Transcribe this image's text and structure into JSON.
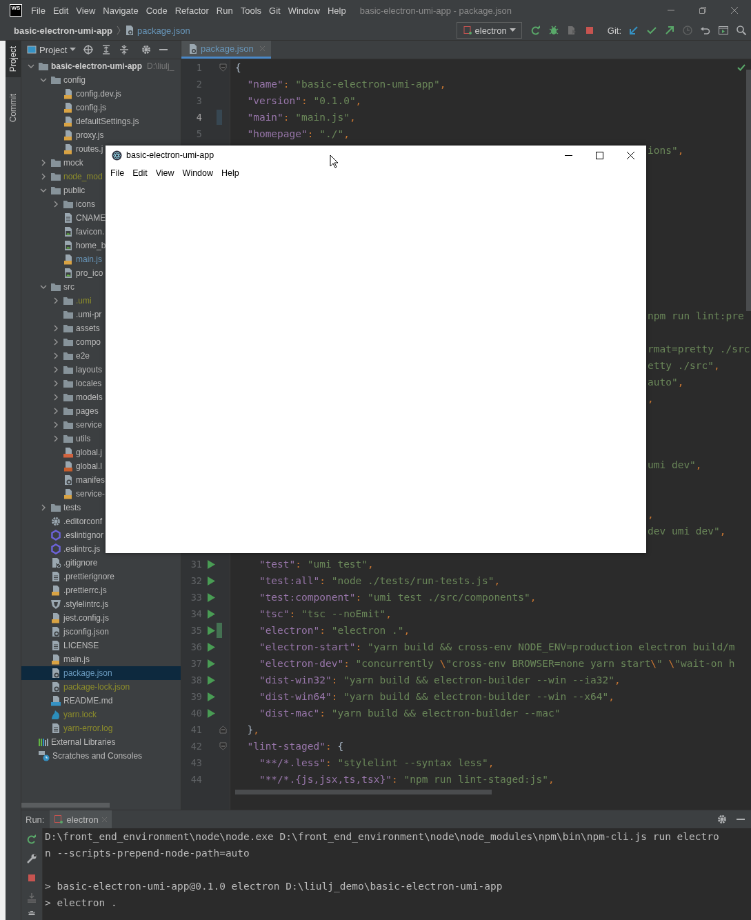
{
  "ide_title_bar": {
    "logo": "WS",
    "menu": [
      {
        "label": "File"
      },
      {
        "label": "Edit"
      },
      {
        "label": "View"
      },
      {
        "label": "Navigate"
      },
      {
        "label": "Code"
      },
      {
        "label": "Refactor"
      },
      {
        "label": "Run"
      },
      {
        "label": "Tools"
      },
      {
        "label": "Git"
      },
      {
        "label": "Window"
      },
      {
        "label": "Help"
      }
    ],
    "title": "basic-electron-umi-app - package.json"
  },
  "navigation_bar": {
    "project": "basic-electron-umi-app",
    "file": "package.json",
    "run_config": "electron",
    "git_label": "Git:"
  },
  "tool_stripe": [
    {
      "label": "Project",
      "selected": true
    },
    {
      "label": "Commit",
      "selected": false
    }
  ],
  "project_panel": {
    "title": "Project",
    "tree": [
      {
        "name": "basic-electron-umi-app",
        "path": "D:\\liulj_",
        "kind": "root",
        "expanded": true,
        "selected": false,
        "color": "#cfcfcf",
        "children": [
          {
            "name": "config",
            "kind": "folder",
            "expanded": true,
            "selected": false,
            "color": "#bbbbbb",
            "children": [
              {
                "name": "config.dev.js",
                "kind": "js",
                "selected": false,
                "color": "#bbbbbb"
              },
              {
                "name": "config.js",
                "kind": "js",
                "selected": false,
                "color": "#bbbbbb"
              },
              {
                "name": "defaultSettings.js",
                "kind": "js",
                "selected": false,
                "color": "#bbbbbb"
              },
              {
                "name": "proxy.js",
                "kind": "js",
                "selected": false,
                "color": "#bbbbbb"
              },
              {
                "name": "routes.j",
                "kind": "js",
                "selected": false,
                "color": "#bbbbbb"
              }
            ]
          },
          {
            "name": "mock",
            "kind": "folder",
            "expanded": false,
            "selected": false,
            "color": "#bbbbbb"
          },
          {
            "name": "node_mod",
            "kind": "folder",
            "expanded": false,
            "selected": false,
            "color": "#8d8d2b"
          },
          {
            "name": "public",
            "kind": "folder",
            "expanded": true,
            "selected": false,
            "color": "#bbbbbb",
            "children": [
              {
                "name": "icons",
                "kind": "folder",
                "expanded": false,
                "selected": false,
                "color": "#bbbbbb"
              },
              {
                "name": "CNAME",
                "kind": "text",
                "selected": false,
                "color": "#bbbbbb"
              },
              {
                "name": "favicon.",
                "kind": "image",
                "selected": false,
                "color": "#bbbbbb"
              },
              {
                "name": "home_b",
                "kind": "image",
                "selected": false,
                "color": "#bbbbbb"
              },
              {
                "name": "main.js",
                "kind": "js",
                "selected": false,
                "color": "#6897bb"
              },
              {
                "name": "pro_ico",
                "kind": "image",
                "selected": false,
                "color": "#bbbbbb"
              }
            ]
          },
          {
            "name": "src",
            "kind": "folder",
            "expanded": true,
            "selected": false,
            "color": "#bbbbbb",
            "children": [
              {
                "name": ".umi",
                "kind": "folder",
                "expanded": false,
                "selected": false,
                "color": "#8d8d2b"
              },
              {
                "name": ".umi-pr",
                "kind": "folder",
                "selected": false,
                "color": "#bbbbbb"
              },
              {
                "name": "assets",
                "kind": "folder",
                "expanded": false,
                "selected": false,
                "color": "#bbbbbb"
              },
              {
                "name": "compo",
                "kind": "folder",
                "expanded": false,
                "selected": false,
                "color": "#bbbbbb"
              },
              {
                "name": "e2e",
                "kind": "folder",
                "expanded": false,
                "selected": false,
                "color": "#bbbbbb"
              },
              {
                "name": "layouts",
                "kind": "folder",
                "expanded": false,
                "selected": false,
                "color": "#bbbbbb"
              },
              {
                "name": "locales",
                "kind": "folder",
                "expanded": false,
                "selected": false,
                "color": "#bbbbbb"
              },
              {
                "name": "models",
                "kind": "folder",
                "expanded": false,
                "selected": false,
                "color": "#bbbbbb"
              },
              {
                "name": "pages",
                "kind": "folder",
                "expanded": false,
                "selected": false,
                "color": "#bbbbbb"
              },
              {
                "name": "service",
                "kind": "folder",
                "expanded": false,
                "selected": false,
                "color": "#bbbbbb"
              },
              {
                "name": "utils",
                "kind": "folder",
                "expanded": false,
                "selected": false,
                "color": "#bbbbbb"
              },
              {
                "name": "global.j",
                "kind": "jsx",
                "selected": false,
                "color": "#bbbbbb"
              },
              {
                "name": "global.l",
                "kind": "less",
                "selected": false,
                "color": "#bbbbbb"
              },
              {
                "name": "manifes",
                "kind": "json",
                "selected": false,
                "color": "#bbbbbb"
              },
              {
                "name": "service-",
                "kind": "js",
                "selected": false,
                "color": "#bbbbbb"
              }
            ]
          },
          {
            "name": "tests",
            "kind": "folder",
            "expanded": false,
            "selected": false,
            "color": "#bbbbbb"
          },
          {
            "name": ".editorconf",
            "kind": "gear",
            "selected": false,
            "color": "#bbbbbb"
          },
          {
            "name": ".eslintignor",
            "kind": "eslint",
            "selected": false,
            "color": "#bbbbbb"
          },
          {
            "name": ".eslintrc.js",
            "kind": "eslint",
            "selected": false,
            "color": "#bbbbbb"
          },
          {
            "name": ".gitignore",
            "kind": "gitignore",
            "selected": false,
            "color": "#bbbbbb"
          },
          {
            "name": ".prettierignore",
            "kind": "text",
            "selected": false,
            "color": "#bbbbbb"
          },
          {
            "name": ".prettierrc.js",
            "kind": "js",
            "selected": false,
            "color": "#bbbbbb"
          },
          {
            "name": ".stylelintrc.js",
            "kind": "stylelint",
            "selected": false,
            "color": "#bbbbbb"
          },
          {
            "name": "jest.config.js",
            "kind": "js",
            "selected": false,
            "color": "#bbbbbb"
          },
          {
            "name": "jsconfig.json",
            "kind": "json",
            "selected": false,
            "color": "#bbbbbb"
          },
          {
            "name": "LICENSE",
            "kind": "text",
            "selected": false,
            "color": "#bbbbbb"
          },
          {
            "name": "main.js",
            "kind": "js",
            "selected": false,
            "color": "#bbbbbb"
          },
          {
            "name": "package.json",
            "kind": "json",
            "selected": true,
            "color": "#6897bb"
          },
          {
            "name": "package-lock.json",
            "kind": "json",
            "selected": false,
            "color": "#8d8d2b"
          },
          {
            "name": "README.md",
            "kind": "md",
            "selected": false,
            "color": "#bbbbbb"
          },
          {
            "name": "yarn.lock",
            "kind": "yarn",
            "selected": false,
            "color": "#8d8d2b"
          },
          {
            "name": "yarn-error.log",
            "kind": "text",
            "selected": false,
            "color": "#8d8d2b"
          }
        ]
      },
      {
        "name": "External Libraries",
        "kind": "libraries",
        "selected": false,
        "color": "#bbbbbb"
      },
      {
        "name": "Scratches and Consoles",
        "kind": "scratches",
        "selected": false,
        "color": "#bbbbbb"
      }
    ]
  },
  "editor": {
    "tabs": [
      {
        "label": "package.json",
        "selected": true
      }
    ],
    "lines": [
      {
        "number": "1",
        "kind": "top",
        "runnable": false,
        "fold": {
          "kind": "start"
        },
        "tokens": [
          {
            "kind": "brace",
            "text": "{"
          }
        ]
      },
      {
        "number": "2",
        "kind": "member",
        "runnable": false,
        "tokens": [
          {
            "kind": "key",
            "text": "\"name\""
          },
          {
            "kind": "punct",
            "text": ": "
          },
          {
            "kind": "string",
            "text": "\"basic-electron-umi-app\""
          },
          {
            "kind": "punct",
            "text": ","
          }
        ]
      },
      {
        "number": "3",
        "kind": "member",
        "runnable": false,
        "tokens": [
          {
            "kind": "key",
            "text": "\"version\""
          },
          {
            "kind": "punct",
            "text": ": "
          },
          {
            "kind": "string",
            "text": "\"0.1.0\""
          },
          {
            "kind": "punct",
            "text": ","
          }
        ]
      },
      {
        "number": "4",
        "kind": "member",
        "runnable": false,
        "current": true,
        "color": "#374752",
        "tokens": [
          {
            "kind": "key",
            "text": "\"main\""
          },
          {
            "kind": "punct",
            "text": ": "
          },
          {
            "kind": "string",
            "text": "\"main.js\""
          },
          {
            "kind": "punct",
            "text": ","
          }
        ]
      },
      {
        "number": "5",
        "kind": "member",
        "runnable": false,
        "tokens": [
          {
            "kind": "key",
            "text": "\"homepage\""
          },
          {
            "kind": "punct",
            "text": ": "
          },
          {
            "kind": "string",
            "text": "\"./\""
          },
          {
            "kind": "punct",
            "text": ","
          }
        ]
      },
      {
        "kind": "fragment",
        "tokens": [
          {
            "kind": "string",
            "text": "ions\""
          },
          {
            "kind": "punct",
            "text": ","
          }
        ]
      },
      {
        "kind": "covered"
      },
      {
        "kind": "covered"
      },
      {
        "kind": "covered"
      },
      {
        "kind": "covered"
      },
      {
        "kind": "covered"
      },
      {
        "kind": "covered"
      },
      {
        "kind": "covered"
      },
      {
        "kind": "covered"
      },
      {
        "kind": "covered"
      },
      {
        "kind": "fragment",
        "tokens": [
          {
            "kind": "string",
            "text": "npm run lint:pre"
          }
        ]
      },
      {
        "kind": "covered"
      },
      {
        "kind": "fragment",
        "tokens": [
          {
            "kind": "string",
            "text": "rmat=pretty ./src"
          }
        ]
      },
      {
        "kind": "fragment",
        "tokens": [
          {
            "kind": "string",
            "text": "etty ./src\""
          },
          {
            "kind": "punct",
            "text": ","
          }
        ]
      },
      {
        "kind": "fragment",
        "tokens": [
          {
            "kind": "string",
            "text": "auto\""
          },
          {
            "kind": "punct",
            "text": ","
          }
        ]
      },
      {
        "kind": "fragment",
        "tokens": [
          {
            "kind": "punct",
            "text": ","
          }
        ]
      },
      {
        "kind": "covered"
      },
      {
        "kind": "covered"
      },
      {
        "kind": "covered"
      },
      {
        "kind": "fragment",
        "tokens": [
          {
            "kind": "string",
            "text": "umi dev\""
          },
          {
            "kind": "punct",
            "text": ","
          }
        ]
      },
      {
        "kind": "covered"
      },
      {
        "kind": "covered"
      },
      {
        "kind": "fragment",
        "tokens": [
          {
            "kind": "punct",
            "text": ","
          }
        ]
      },
      {
        "kind": "fragment",
        "tokens": [
          {
            "kind": "string",
            "text": "dev umi dev\""
          },
          {
            "kind": "punct",
            "text": ","
          }
        ]
      },
      {
        "kind": "covered"
      },
      {
        "number": "31",
        "kind": "entry",
        "runnable": true,
        "tokens": [
          {
            "kind": "key",
            "text": "\"test\""
          },
          {
            "kind": "punct",
            "text": ": "
          },
          {
            "kind": "string",
            "text": "\"umi test\""
          },
          {
            "kind": "punct",
            "text": ","
          }
        ]
      },
      {
        "number": "32",
        "kind": "entry",
        "runnable": true,
        "tokens": [
          {
            "kind": "key",
            "text": "\"test:all\""
          },
          {
            "kind": "punct",
            "text": ": "
          },
          {
            "kind": "string",
            "text": "\"node ./tests/run-tests.js\""
          },
          {
            "kind": "punct",
            "text": ","
          }
        ]
      },
      {
        "number": "33",
        "kind": "entry",
        "runnable": true,
        "tokens": [
          {
            "kind": "key",
            "text": "\"test:component\""
          },
          {
            "kind": "punct",
            "text": ": "
          },
          {
            "kind": "string",
            "text": "\"umi test ./src/components\""
          },
          {
            "kind": "punct",
            "text": ","
          }
        ]
      },
      {
        "number": "34",
        "kind": "entry",
        "runnable": true,
        "tokens": [
          {
            "kind": "key",
            "text": "\"tsc\""
          },
          {
            "kind": "punct",
            "text": ": "
          },
          {
            "kind": "string",
            "text": "\"tsc --noEmit\""
          },
          {
            "kind": "punct",
            "text": ","
          }
        ]
      },
      {
        "number": "35",
        "kind": "entry",
        "runnable": true,
        "color": "#447152",
        "tokens": [
          {
            "kind": "key",
            "text": "\"electron\""
          },
          {
            "kind": "punct",
            "text": ": "
          },
          {
            "kind": "string",
            "text": "\"electron .\""
          },
          {
            "kind": "punct",
            "text": ","
          }
        ]
      },
      {
        "number": "36",
        "kind": "entry",
        "runnable": true,
        "tokens": [
          {
            "kind": "key",
            "text": "\"electron-start\""
          },
          {
            "kind": "punct",
            "text": ": "
          },
          {
            "kind": "string",
            "text": "\"yarn build && cross-env NODE_ENV=production electron build/m"
          }
        ]
      },
      {
        "number": "37",
        "kind": "entry",
        "runnable": true,
        "tokens": [
          {
            "kind": "key",
            "text": "\"electron-dev\""
          },
          {
            "kind": "punct",
            "text": ": "
          },
          {
            "kind": "string",
            "text": "\"concurrently "
          },
          {
            "kind": "punct",
            "text": "\\"
          },
          {
            "kind": "string",
            "text": "\"cross-env BROWSER=none yarn start"
          },
          {
            "kind": "punct",
            "text": "\\"
          },
          {
            "kind": "string",
            "text": "\" "
          },
          {
            "kind": "punct",
            "text": "\\"
          },
          {
            "kind": "string",
            "text": "\"wait-on h"
          }
        ]
      },
      {
        "number": "38",
        "kind": "entry",
        "runnable": true,
        "tokens": [
          {
            "kind": "key",
            "text": "\"dist-win32\""
          },
          {
            "kind": "punct",
            "text": ": "
          },
          {
            "kind": "string",
            "text": "\"yarn build && electron-builder --win --ia32\""
          },
          {
            "kind": "punct",
            "text": ","
          }
        ]
      },
      {
        "number": "39",
        "kind": "entry",
        "runnable": true,
        "tokens": [
          {
            "kind": "key",
            "text": "\"dist-win64\""
          },
          {
            "kind": "punct",
            "text": ": "
          },
          {
            "kind": "string",
            "text": "\"yarn build && electron-builder --win --x64\""
          },
          {
            "kind": "punct",
            "text": ","
          }
        ]
      },
      {
        "number": "40",
        "kind": "entry",
        "runnable": true,
        "tokens": [
          {
            "kind": "key",
            "text": "\"dist-mac\""
          },
          {
            "kind": "punct",
            "text": ": "
          },
          {
            "kind": "string",
            "text": "\"yarn build && electron-builder --mac\""
          }
        ]
      },
      {
        "number": "41",
        "kind": "member",
        "runnable": false,
        "fold": {
          "kind": "end"
        },
        "tokens": [
          {
            "kind": "brace",
            "text": "}"
          },
          {
            "kind": "punct",
            "text": ","
          }
        ]
      },
      {
        "number": "42",
        "kind": "member",
        "runnable": false,
        "fold": {
          "kind": "start"
        },
        "tokens": [
          {
            "kind": "key",
            "text": "\"lint-staged\""
          },
          {
            "kind": "punct",
            "text": ": "
          },
          {
            "kind": "brace",
            "text": "{"
          }
        ]
      },
      {
        "number": "43",
        "kind": "entry",
        "runnable": false,
        "tokens": [
          {
            "kind": "key",
            "text": "\"**/*.less\""
          },
          {
            "kind": "punct",
            "text": ": "
          },
          {
            "kind": "string",
            "text": "\"stylelint --syntax less\""
          },
          {
            "kind": "punct",
            "text": ","
          }
        ]
      },
      {
        "number": "44",
        "kind": "entry",
        "runnable": false,
        "tokens": [
          {
            "kind": "key",
            "text": "\"**/*.{js,jsx,ts,tsx}\""
          },
          {
            "kind": "punct",
            "text": ": "
          },
          {
            "kind": "string",
            "text": "\"npm run lint-staged:js\""
          },
          {
            "kind": "punct",
            "text": ","
          }
        ]
      }
    ]
  },
  "app_window": {
    "title": "basic-electron-umi-app",
    "menu": [
      {
        "label": "File"
      },
      {
        "label": "Edit"
      },
      {
        "label": "View"
      },
      {
        "label": "Window"
      },
      {
        "label": "Help"
      }
    ]
  },
  "run_panel": {
    "label": "Run:",
    "tabs": [
      {
        "label": "electron",
        "selected": true
      }
    ],
    "output": [
      [
        "D:\\front_end_environment\\node\\node.exe D:\\front_end_environment\\node\\node_modules\\npm\\bin\\npm-cli.js run electro",
        "n --scripts-prepend-node-path=auto"
      ],
      [
        "> basic-electron-umi-app@0.1.0 electron D:\\liulj_demo\\basic-electron-umi-app",
        "> electron ."
      ]
    ]
  }
}
